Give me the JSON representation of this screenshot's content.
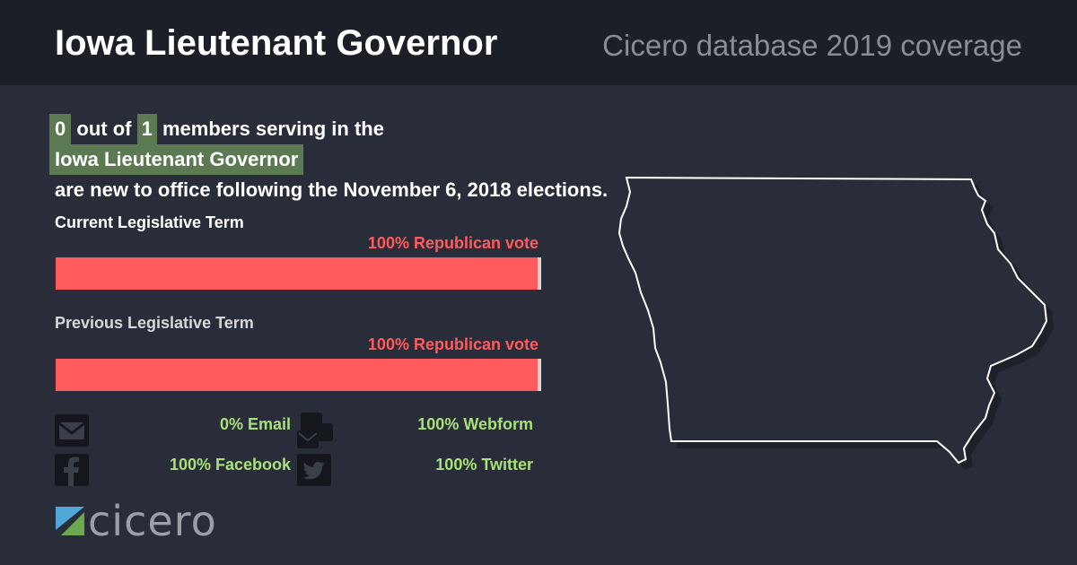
{
  "header": {
    "title": "Iowa Lieutenant Governor",
    "subtitle": "Cicero database 2019 coverage"
  },
  "headline": {
    "new_count": "0",
    "out_of_text": "out of",
    "total_count": "1",
    "members_text": "members serving in the",
    "body_name": "Iowa Lieutenant Governor",
    "suffix": "are new to office following the November 6, 2018 elections."
  },
  "terms": [
    {
      "label": "Current Legislative Term",
      "vote_text": "100% Republican vote",
      "republican_share": 1.0
    },
    {
      "label": "Previous Legislative Term",
      "vote_text": "100% Republican vote",
      "republican_share": 1.0
    }
  ],
  "contact": {
    "email": "0% Email",
    "webform": "100% Webform",
    "facebook": "100% Facebook",
    "twitter": "100% Twitter"
  },
  "logo": {
    "text": "cicero"
  },
  "colors": {
    "background": "#292d39",
    "header_bg": "#1c1f27",
    "highlight": "#5c7a52",
    "republican": "#ff5a5e",
    "contact_text": "#a8e07a"
  },
  "icons": [
    "email-icon",
    "webform-icon",
    "facebook-icon",
    "twitter-icon",
    "iowa-map"
  ]
}
